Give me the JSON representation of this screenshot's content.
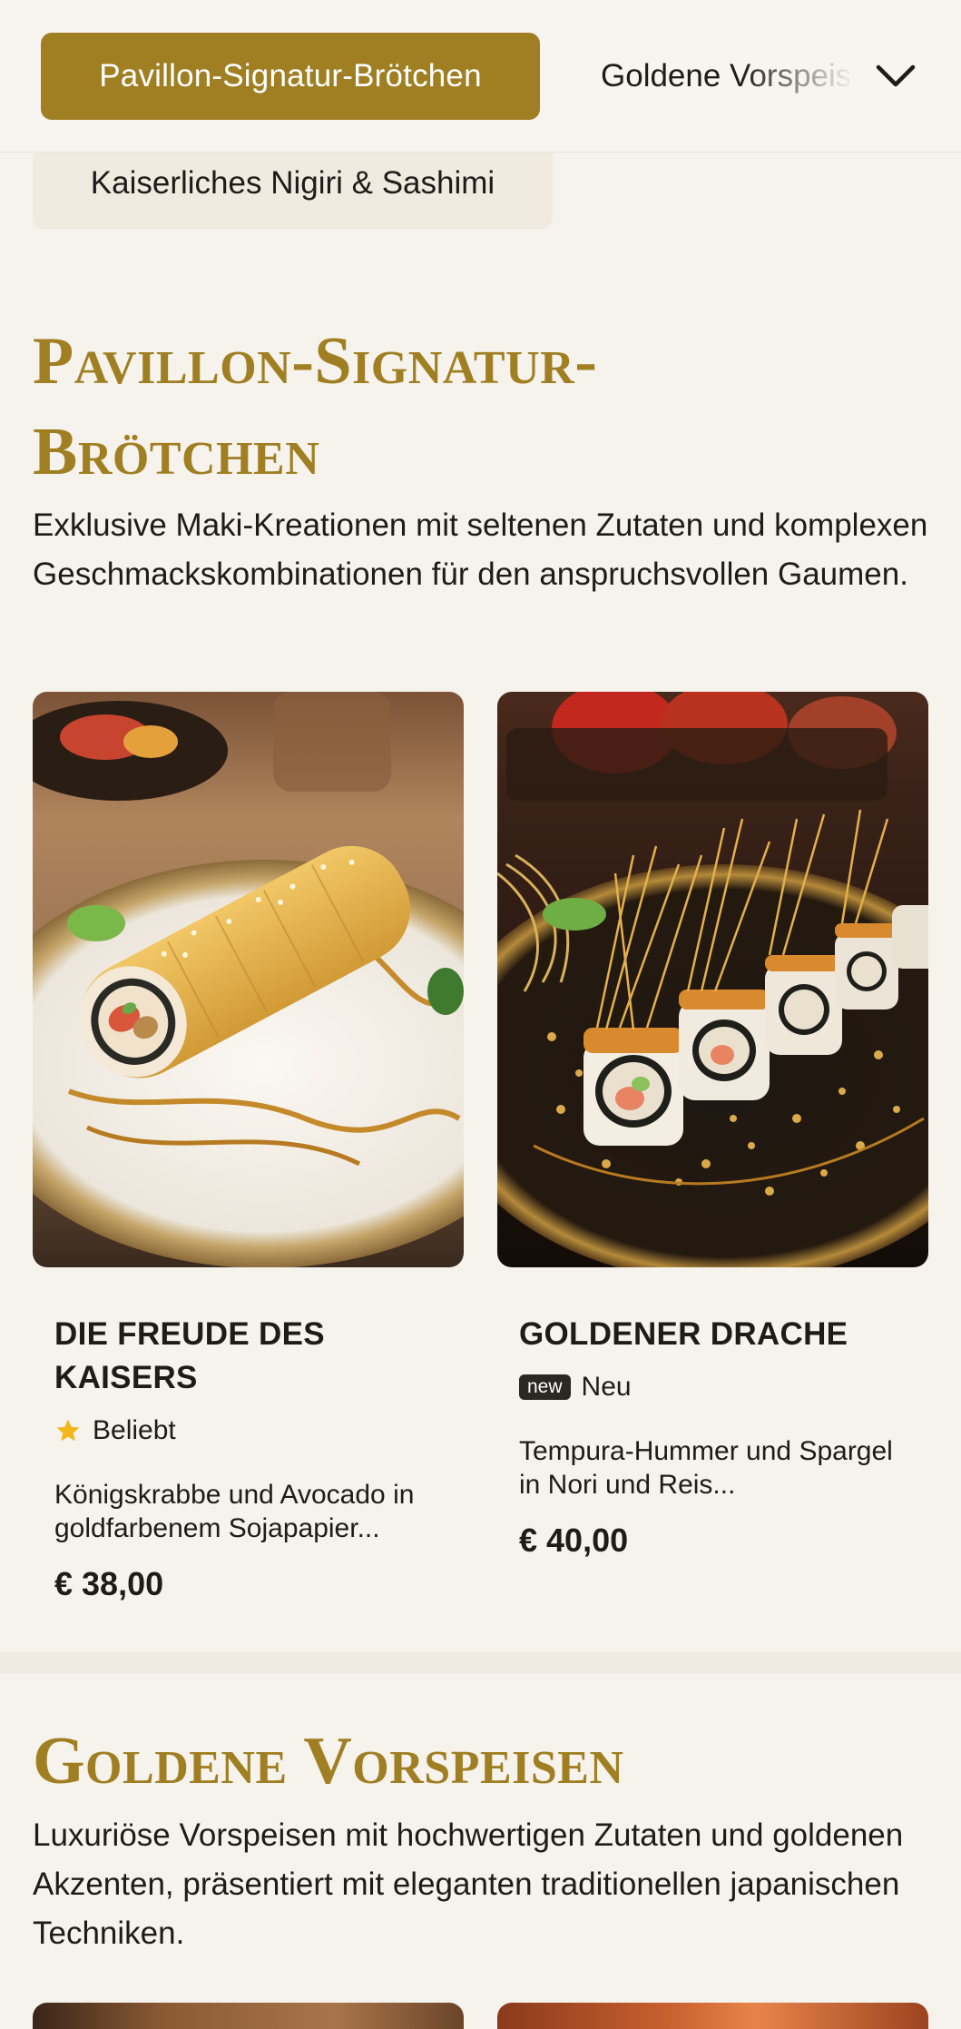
{
  "nav": {
    "active_label": "Pavillon-Signatur-Brötchen",
    "next_label": "Goldene Vorspeisen",
    "secondary_label": "Kaiserliches Nigiri & Sashimi"
  },
  "sections": [
    {
      "title_line1": "Pavillon-Signatur-",
      "title_line2": "Brötchen",
      "description": "Exklusive Maki-Kreationen mit seltenen Zutaten und komplexen Geschmackskombinationen für den anspruchsvollen Gaumen.",
      "items": [
        {
          "name": "Die Freude des Kaisers",
          "badge_label": "Beliebt",
          "description": "Königskrabbe und Avocado in goldfarbenem Sojapapier...",
          "price": "€ 38,00"
        },
        {
          "name": "Goldener Drache",
          "tag": "new",
          "badge_label": "Neu",
          "description": "Tempura-Hummer und Spargel in Nori und Reis...",
          "price": "€ 40,00"
        }
      ]
    },
    {
      "title": "Goldene Vorspeisen",
      "description": "Luxuriöse Vorspeisen mit hochwertigen Zutaten und goldenen Akzenten, präsentiert mit eleganten traditionellen japanischen Techniken."
    }
  ],
  "colors": {
    "accent": "#a07f23",
    "background": "#f6f2ec",
    "star": "#f2b71b"
  }
}
